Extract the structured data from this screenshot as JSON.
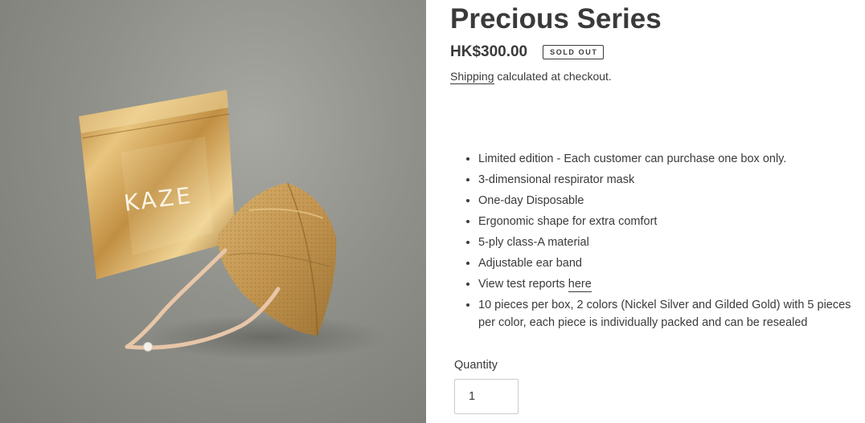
{
  "product": {
    "title": "Precious Series",
    "price": "HK$300.00",
    "badge": "SOLD OUT",
    "shipping_link": "Shipping",
    "shipping_suffix": " calculated at checkout.",
    "image": {
      "package_brand_text": "KAZE",
      "colors": {
        "background": "#8f908a",
        "gold": "#c9a05c",
        "strap": "#e8c6a8"
      }
    }
  },
  "features": [
    "Limited edition - Each customer can purchase one box only.",
    "3-dimensional respirator mask",
    "One-day Disposable",
    "Ergonomic shape for extra comfort",
    "5-ply class-A material",
    "Adjustable ear band",
    {
      "prefix": "View test reports ",
      "link": "here"
    },
    "10 pieces per box, 2 colors (Nickel Silver and Gilded Gold) with 5 pieces per color, each piece is individually packed and can be resealed"
  ],
  "quantity": {
    "label": "Quantity",
    "value": "1"
  }
}
